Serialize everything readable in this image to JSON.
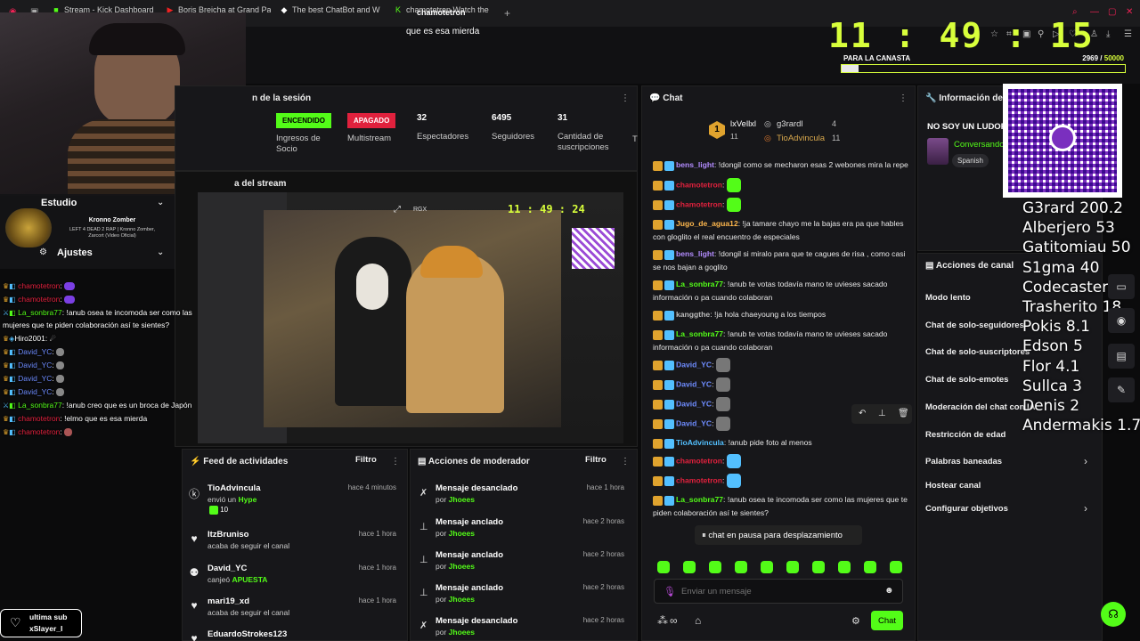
{
  "browser": {
    "tabs": [
      {
        "label": "Stream - Kick Dashboard"
      },
      {
        "label": "Boris Brejcha at Grand Pa"
      },
      {
        "label": "The best ChatBot and W"
      },
      {
        "label": "chamotetron Watch the"
      }
    ],
    "new_tab": "+"
  },
  "caption": {
    "text": "que es esa mierda",
    "name": "chamotetron"
  },
  "clock": {
    "h": "11",
    "m": "49",
    "s": "15",
    "sep": ":"
  },
  "goal": {
    "label": "PARA LA CANASTA",
    "current": "2969",
    "target": "50000",
    "progress": 0.06
  },
  "session": {
    "title": "n de la sesión",
    "stats": [
      {
        "pill": "ENCENDIDO",
        "label": "Ingresos de Socio",
        "pill_color": "#53fc18"
      },
      {
        "pill": "APAGADO",
        "label": "Multistream",
        "pill_color": "#e0213d"
      },
      {
        "num": "32",
        "label": "Espectadores"
      },
      {
        "num": "6495",
        "label": "Seguidores"
      },
      {
        "num": "31",
        "label": "Cantidad de suscripciones"
      },
      {
        "num": "T"
      }
    ]
  },
  "stream_preview": {
    "title": "a del stream",
    "time": "11 : 49 : 24",
    "tag": "RGX"
  },
  "sidebar_overlay": {
    "studio": "Estudio",
    "adjustments": "Ajustes",
    "now_playing_title": "Kronno Zomber",
    "now_playing_sub": "LEFT 4 DEAD 2 RAP | Kronno Zomber, Zarcort (Video Oficial)"
  },
  "left_chat": [
    {
      "user": "chamotetron",
      "text": ""
    },
    {
      "user": "chamotetron",
      "text": ""
    },
    {
      "user": "La_sonbra77",
      "text": "!anub osea te incomoda ser como las"
    },
    {
      "user": "",
      "text": "mujeres que te piden colaboración así te sientes?"
    },
    {
      "user": "Hiro2001",
      "text": ""
    },
    {
      "user": "David_YC",
      "text": ""
    },
    {
      "user": "David_YC",
      "text": ""
    },
    {
      "user": "David_YC",
      "text": ""
    },
    {
      "user": "David_YC",
      "text": ""
    },
    {
      "user": "La_sonbra77",
      "text": "!anub creo que es un broca de Japón"
    },
    {
      "user": "chamotetron",
      "text": "!elmo que es esa mierda"
    },
    {
      "user": "chamotetron",
      "text": ""
    }
  ],
  "last_sub": {
    "label": "ultima sub",
    "user": "xSlayer_I"
  },
  "chat": {
    "title": "Chat",
    "top_gifters": [
      {
        "rank": "1",
        "name": "lxVellxl",
        "count": "11"
      },
      {
        "name": "g3rardl",
        "count": "4"
      },
      {
        "name": "TioAdvincula",
        "count": "11"
      }
    ],
    "messages": [
      {
        "user": "bens_light",
        "color": "#b38cff",
        "text": "!dongil como se mecharon esas 2 webones mira la repe"
      },
      {
        "user": "chamotetron",
        "color": "#e0213d",
        "text": ""
      },
      {
        "user": "chamotetron",
        "color": "#e0213d",
        "text": ""
      },
      {
        "user": "Jugo_de_agua12",
        "color": "#ffb84d",
        "text": "!ja tamare chayo me la bajas era pa que hables con gloglito el real encuentro de especiales"
      },
      {
        "user": "bens_light",
        "color": "#b38cff",
        "text": "!dongil si miralo para que te cagues de risa , como casi se nos bajan a goglito"
      },
      {
        "user": "La_sonbra77",
        "color": "#53fc18",
        "text": "!anub te votas todavía mano te uvieses sacado información o pa cuando colaboran"
      },
      {
        "user": "kanggthe",
        "color": "#bbbbbb",
        "text": "!ja hola chaeyoung a los tiempos"
      },
      {
        "user": "La_sonbra77",
        "color": "#53fc18",
        "text": "!anub te votas todavía mano te uvieses sacado información o pa cuando colaboran"
      },
      {
        "user": "David_YC",
        "color": "#6e8cff",
        "text": ""
      },
      {
        "user": "David_YC",
        "color": "#6e8cff",
        "text": ""
      },
      {
        "user": "David_YC",
        "color": "#6e8cff",
        "text": ""
      },
      {
        "user": "David_YC",
        "color": "#6e8cff",
        "text": ""
      },
      {
        "user": "TioAdvincula",
        "color": "#53c0ff",
        "text": "!anub pide foto al menos"
      },
      {
        "user": "chamotetron",
        "color": "#e0213d",
        "text": ""
      },
      {
        "user": "chamotetron",
        "color": "#e0213d",
        "text": ""
      },
      {
        "user": "La_sonbra77",
        "color": "#53fc18",
        "text": "!anub osea te incomoda ser como las mujeres que te piden colaboración así te sientes?"
      }
    ],
    "paused": "chat en pausa para desplazamiento",
    "input_placeholder": "Enviar un mensaje",
    "send": "Chat"
  },
  "channel_info": {
    "title": "Información del s",
    "status": "NO SOY UN LUDOP",
    "category": "Conversando",
    "language": "Spanish"
  },
  "channel_actions": {
    "title": "Acciones de canal",
    "items": [
      "Modo lento",
      "Chat de solo-seguidores",
      "Chat de solo-suscriptores",
      "Chat de solo-emotes",
      "Moderación del chat con IA",
      "Restricción de edad",
      "Palabras baneadas",
      "Hostear canal",
      "Configurar objetivos"
    ]
  },
  "leaderboard": [
    "G3rard 200.2",
    "Alberjero 53",
    "Gatitomiau 50",
    "S1gma 40",
    "Codecaster 20",
    "Trasherito 18",
    "Pokis 8.1",
    "Edson 5",
    "Flor 4.1",
    "Sullca 3",
    "Denis 2",
    "Andermakis 1.7"
  ],
  "activity": {
    "title": "Feed de actividades",
    "filter": "Filtro",
    "items": [
      {
        "icon": "kick-icon",
        "user": "TioAdvincula",
        "desc": "envió un",
        "highlight": "Hype",
        "extra": "10",
        "time": "hace 4 minutos"
      },
      {
        "icon": "heart-icon",
        "user": "ItzBruniso",
        "desc": "acaba de seguir el canal",
        "time": "hace 1 hora"
      },
      {
        "icon": "points-icon",
        "user": "David_YC",
        "desc": "canjeó",
        "highlight": "APUESTA",
        "time": "hace 1 hora"
      },
      {
        "icon": "heart-icon",
        "user": "mari19_xd",
        "desc": "acaba de seguir el canal",
        "time": "hace 1 hora"
      },
      {
        "icon": "heart-icon",
        "user": "EduardoStrokes123",
        "desc": "",
        "time": ""
      }
    ]
  },
  "mod_actions": {
    "title": "Acciones de moderador",
    "filter": "Filtro",
    "items": [
      {
        "icon": "unpin-icon",
        "action": "Mensaje desanclado",
        "by": "por",
        "mod": "Jhoees",
        "time": "hace 1 hora"
      },
      {
        "icon": "pin-icon",
        "action": "Mensaje anclado",
        "by": "por",
        "mod": "Jhoees",
        "time": "hace 2 horas"
      },
      {
        "icon": "pin-icon",
        "action": "Mensaje anclado",
        "by": "por",
        "mod": "Jhoees",
        "time": "hace 2 horas"
      },
      {
        "icon": "pin-icon",
        "action": "Mensaje anclado",
        "by": "por",
        "mod": "Jhoees",
        "time": "hace 2 horas"
      },
      {
        "icon": "unpin-icon",
        "action": "Mensaje desanclado",
        "by": "por",
        "mod": "Jhoees",
        "time": "hace 2 horas"
      }
    ]
  },
  "colors": {
    "accent": "#53fc18",
    "danger": "#e0213d",
    "clock": "#d8ff3b"
  }
}
